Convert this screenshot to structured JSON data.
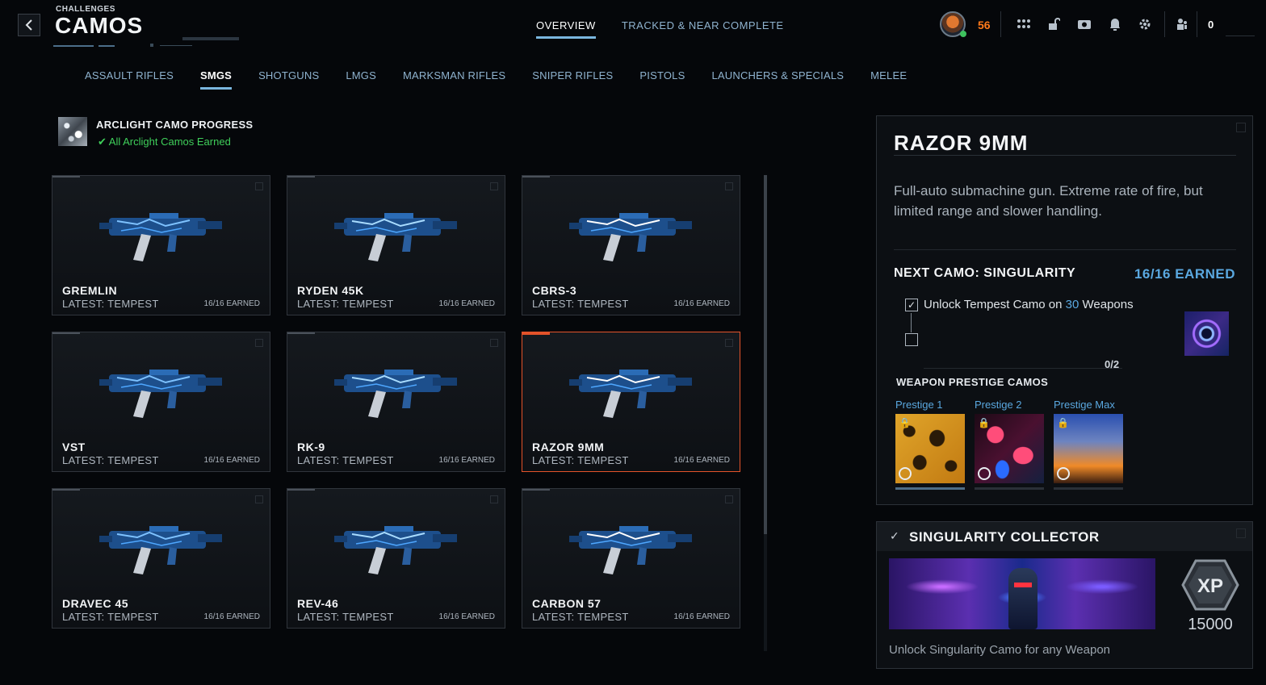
{
  "header": {
    "breadcrumb": "CHALLENGES",
    "title": "CAMOS",
    "tabs": [
      {
        "label": "OVERVIEW",
        "active": true
      },
      {
        "label": "TRACKED & NEAR COMPLETE",
        "active": false
      }
    ],
    "player_level": "56",
    "currency_count": "0",
    "icons": [
      "grid-menu-icon",
      "unlock-icon",
      "camera-icon",
      "bell-icon",
      "gear-icon",
      "squad-icon"
    ]
  },
  "categories": [
    {
      "label": "ASSAULT RIFLES",
      "active": false
    },
    {
      "label": "SMGS",
      "active": true
    },
    {
      "label": "SHOTGUNS",
      "active": false
    },
    {
      "label": "LMGS",
      "active": false
    },
    {
      "label": "MARKSMAN RIFLES",
      "active": false
    },
    {
      "label": "SNIPER RIFLES",
      "active": false
    },
    {
      "label": "PISTOLS",
      "active": false
    },
    {
      "label": "LAUNCHERS & SPECIALS",
      "active": false
    },
    {
      "label": "MELEE",
      "active": false
    }
  ],
  "arclight": {
    "title": "ARCLIGHT CAMO PROGRESS",
    "status": "All Arclight Camos Earned"
  },
  "weapons": [
    {
      "name": "GREMLIN",
      "latest": "LATEST: TEMPEST",
      "earned": "16/16 EARNED",
      "selected": false
    },
    {
      "name": "RYDEN 45K",
      "latest": "LATEST: TEMPEST",
      "earned": "16/16 EARNED",
      "selected": false
    },
    {
      "name": "CBRS-3",
      "latest": "LATEST: TEMPEST",
      "earned": "16/16 EARNED",
      "selected": false
    },
    {
      "name": "VST",
      "latest": "LATEST: TEMPEST",
      "earned": "16/16 EARNED",
      "selected": false
    },
    {
      "name": "RK-9",
      "latest": "LATEST: TEMPEST",
      "earned": "16/16 EARNED",
      "selected": false
    },
    {
      "name": "RAZOR 9MM",
      "latest": "LATEST: TEMPEST",
      "earned": "16/16 EARNED",
      "selected": true
    },
    {
      "name": "DRAVEC 45",
      "latest": "LATEST: TEMPEST",
      "earned": "16/16 EARNED",
      "selected": false
    },
    {
      "name": "REV-46",
      "latest": "LATEST: TEMPEST",
      "earned": "16/16 EARNED",
      "selected": false
    },
    {
      "name": "CARBON 57",
      "latest": "LATEST: TEMPEST",
      "earned": "16/16 EARNED",
      "selected": false
    }
  ],
  "detail": {
    "title": "RAZOR 9MM",
    "description": "Full-auto submachine gun. Extreme rate of fire, but limited range and slower handling.",
    "next_camo": "NEXT CAMO: SINGULARITY",
    "next_earned": "16/16 EARNED",
    "task_prefix": "Unlock Tempest Camo on ",
    "task_count": "30",
    "task_suffix": " Weapons",
    "progress": "0/2",
    "prestige_heading": "WEAPON PRESTIGE CAMOS",
    "prestige": [
      {
        "label": "Prestige 1"
      },
      {
        "label": "Prestige 2"
      },
      {
        "label": "Prestige Max"
      }
    ]
  },
  "collector": {
    "title": "SINGULARITY COLLECTOR",
    "xp_label": "XP",
    "xp_amount": "15000",
    "description": "Unlock Singularity Camo for any Weapon"
  },
  "colors": {
    "accent_blue": "#7ab6de",
    "selected_orange": "#e4532a",
    "success_green": "#3fcf5a",
    "level_orange": "#ff7a1a"
  }
}
